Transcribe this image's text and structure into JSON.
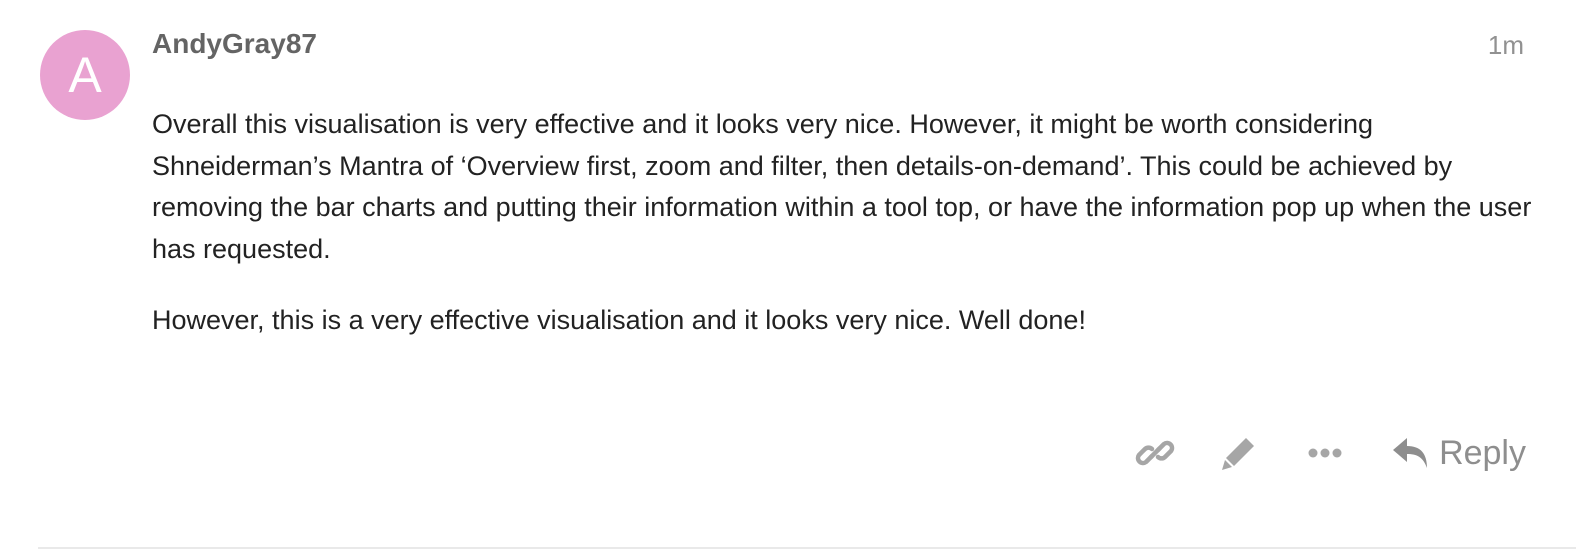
{
  "post": {
    "author": {
      "avatar_letter": "A",
      "avatar_color": "#e9a2d1",
      "username": "AndyGray87"
    },
    "timestamp": "1m",
    "paragraphs": [
      "Overall this visualisation is very effective and it looks very nice. However, it might be worth considering Shneiderman’s Mantra of ‘Overview first, zoom and filter, then details-on-demand’. This could be achieved by removing the bar charts and putting their information within a tool top, or have the information pop up when the user has requested.",
      "However, this is a very effective visualisation and it looks very nice. Well done!"
    ],
    "actions": {
      "link_icon": "link-icon",
      "edit_icon": "pencil-icon",
      "more_icon": "ellipsis-icon",
      "reply_icon": "reply-arrow-icon",
      "reply_label": "Reply"
    }
  }
}
